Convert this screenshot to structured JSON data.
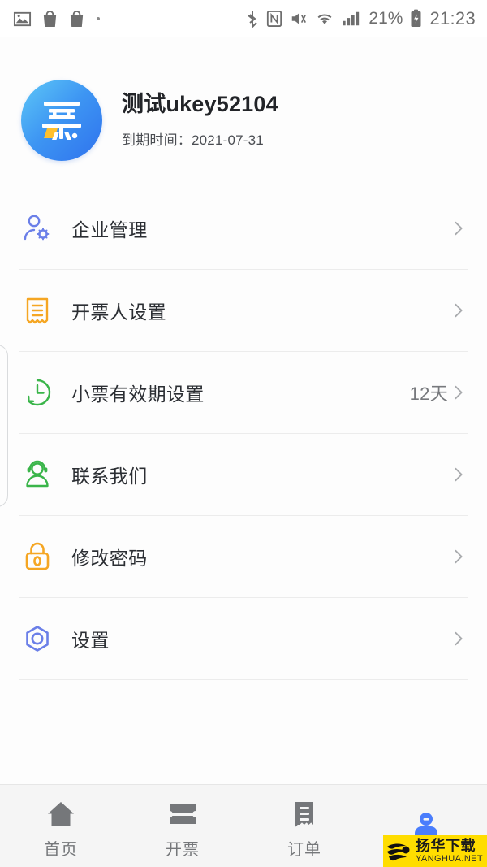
{
  "status_bar": {
    "left_icons": [
      "image-icon",
      "bag-icon",
      "bag-icon",
      "dot-icon"
    ],
    "right_icons": [
      "bluetooth-icon",
      "nfc-icon",
      "mute-icon",
      "wifi-icon",
      "signal-icon"
    ],
    "battery_percent": "21%",
    "battery_icon": "battery-charging-icon",
    "time": "21:23"
  },
  "profile": {
    "app_icon_glyph": "票",
    "app_icon_name": "piao-app-icon",
    "name": "测试ukey52104",
    "expire_label": "到期时间：2021-07-31"
  },
  "menu": {
    "items": [
      {
        "label": "企业管理",
        "icon": "person-gear-icon",
        "icon_color": "#6b7fe8",
        "value": "",
        "chevron": "chevron-right-icon"
      },
      {
        "label": "开票人设置",
        "icon": "receipt-icon",
        "icon_color": "#f5a623",
        "value": "",
        "chevron": "chevron-right-icon"
      },
      {
        "label": "小票有效期设置",
        "icon": "clock-icon",
        "icon_color": "#3ab54a",
        "value": "12天",
        "chevron": "chevron-right-icon"
      },
      {
        "label": "联系我们",
        "icon": "headset-person-icon",
        "icon_color": "#3ab54a",
        "value": "",
        "chevron": "chevron-right-icon"
      },
      {
        "label": "修改密码",
        "icon": "lock-icon",
        "icon_color": "#f5a623",
        "value": "",
        "chevron": "chevron-right-icon"
      },
      {
        "label": "设置",
        "icon": "hexagon-gear-icon",
        "icon_color": "#6b7fe8",
        "value": "",
        "chevron": "chevron-right-icon"
      }
    ]
  },
  "tabbar": {
    "items": [
      {
        "label": "首页",
        "icon": "home-icon",
        "active": false
      },
      {
        "label": "开票",
        "icon": "ticket-icon",
        "active": false
      },
      {
        "label": "订单",
        "icon": "order-receipt-icon",
        "active": false
      },
      {
        "label": "",
        "icon": "person-icon",
        "active": true
      }
    ],
    "active_color": "#4a7dfc",
    "inactive_color": "#75777a"
  },
  "watermark": {
    "cn_text": "扬华下载",
    "en_text": "YANGHUA.NET",
    "bg_color": "#ffdd00",
    "icon": "globe-logo-icon"
  }
}
